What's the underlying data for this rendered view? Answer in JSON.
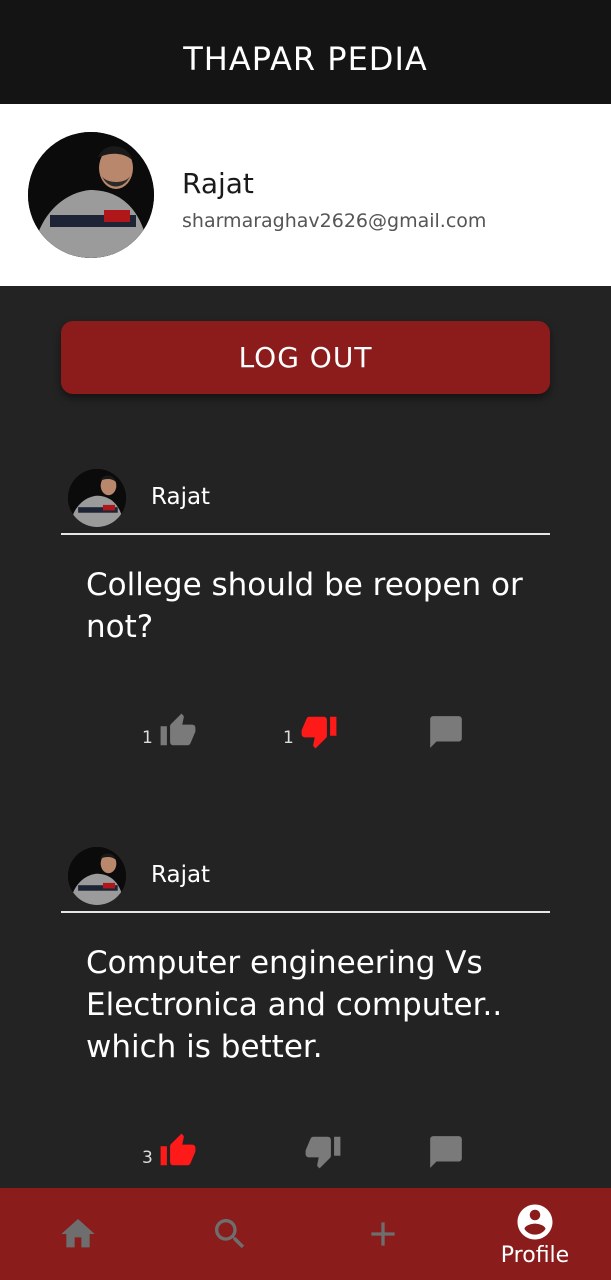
{
  "app": {
    "title": "THAPAR PEDIA"
  },
  "profile": {
    "name": "Rajat",
    "email": "sharmaraghav2626@gmail.com"
  },
  "logout": {
    "label": "LOG OUT"
  },
  "colors": {
    "accent": "#8c1c1c",
    "active_vote": "#ff1a1a",
    "inactive_icon": "#7a7a7a",
    "background": "#232323"
  },
  "posts": [
    {
      "author": "Rajat",
      "question": "College should be reopen or not?",
      "likes": "1",
      "dislikes": "1",
      "like_active": false,
      "dislike_active": true
    },
    {
      "author": "Rajat",
      "question": "Computer engineering Vs Electronica and computer.. which is better.",
      "likes": "3",
      "dislikes": "",
      "like_active": true,
      "dislike_active": false
    }
  ],
  "bottom_nav": {
    "items": [
      {
        "icon": "home-icon"
      },
      {
        "icon": "search-icon"
      },
      {
        "icon": "add-icon"
      },
      {
        "icon": "account-circle-icon",
        "label": "Profile"
      }
    ]
  }
}
